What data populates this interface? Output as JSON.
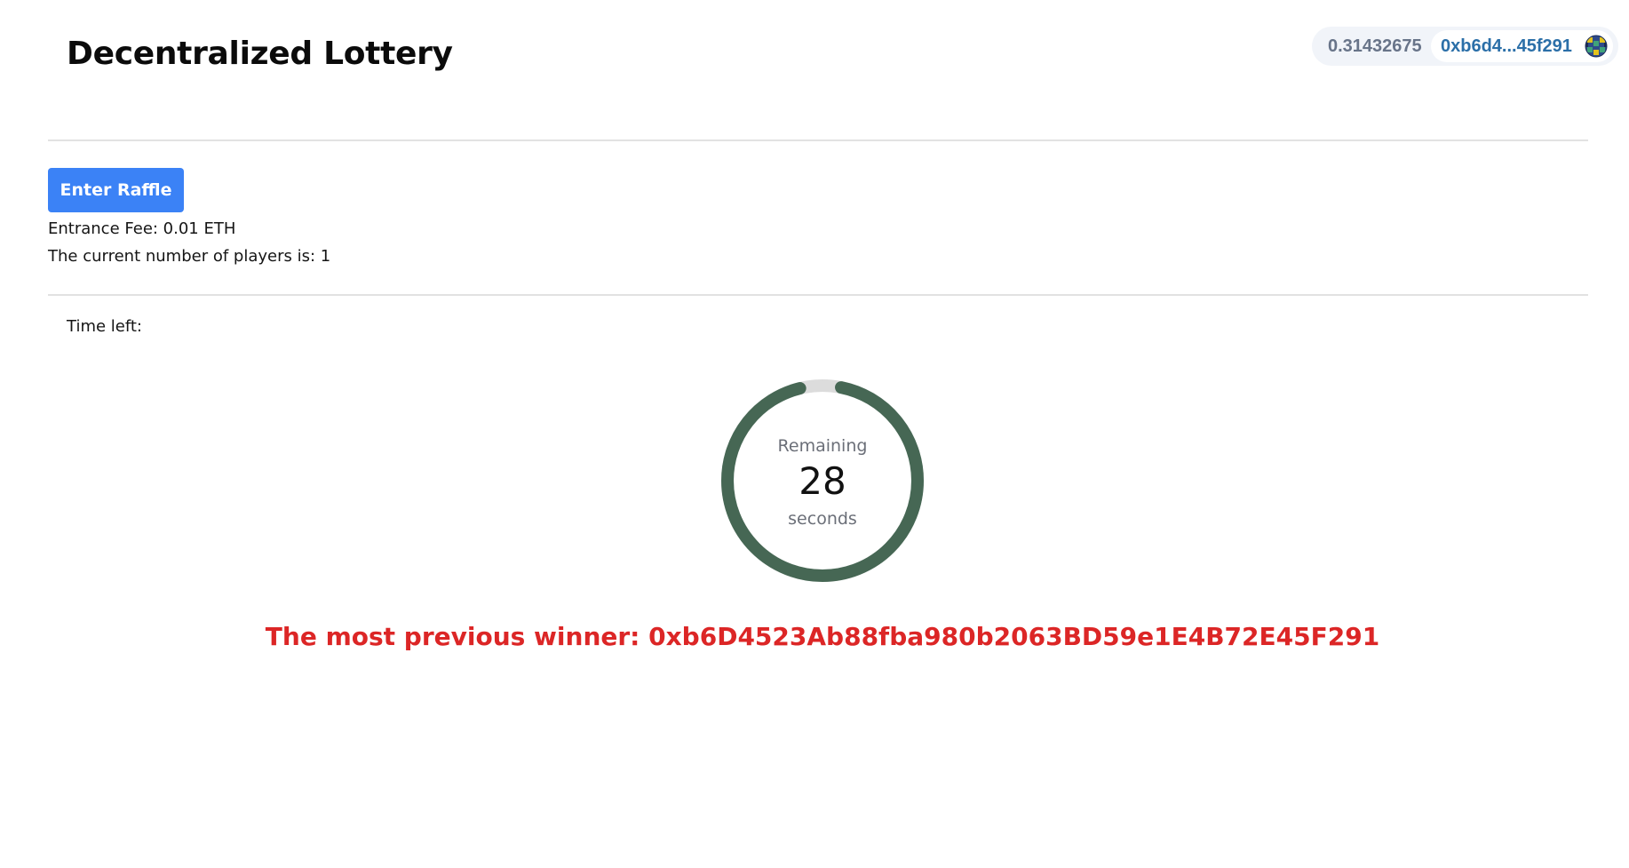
{
  "app": {
    "title": "Decentralized Lottery"
  },
  "wallet": {
    "balance": "0.31432675",
    "address": "0xb6d4...45f291",
    "avatar_icon": "identicon-avatar-icon"
  },
  "raffle": {
    "enter_label": "Enter Raffle",
    "fee_text": "Entrance Fee: 0.01 ETH",
    "players_text": "The current number of players is: 1"
  },
  "timer": {
    "heading": "Time left:",
    "remaining_label": "Remaining",
    "value": "28",
    "unit_label": "seconds",
    "progress_fraction": 0.93,
    "track_color": "#dcdcdc",
    "progress_color": "#466754"
  },
  "winner": {
    "text": "The most previous winner: 0xb6D4523Ab88fba980b2063BD59e1E4B72E45F291"
  },
  "colors": {
    "accent": "#3b82f6",
    "winner": "#dc2626",
    "address": "#2b6fa8"
  }
}
